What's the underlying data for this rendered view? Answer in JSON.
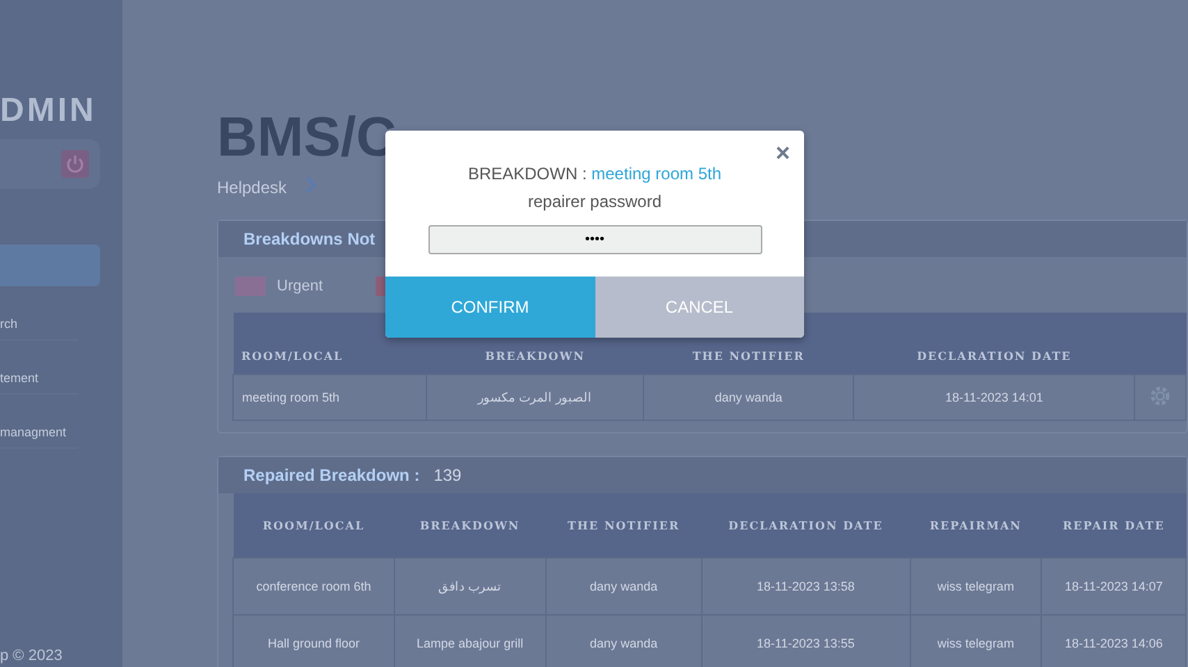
{
  "sidebar": {
    "role": "DMIN",
    "items": [
      {
        "label": "rch",
        "selected": false
      },
      {
        "label": "tement",
        "selected": false
      },
      {
        "label": "managment",
        "selected": false
      }
    ],
    "footer": "p © 2023"
  },
  "page": {
    "title": "BMS/C",
    "breadcrumb": "Helpdesk"
  },
  "pending_panel": {
    "title": "Breakdowns Not",
    "legend": [
      {
        "label": "Urgent",
        "color": "#8a6f95"
      },
      {
        "color": "#8e5e78"
      }
    ],
    "columns": [
      "ROOM/LOCAL",
      "BREAKDOWN",
      "THE NOTIFIER",
      "DECLARATION DATE"
    ],
    "rows": [
      [
        "meeting room 5th",
        "الصبور المرت مكسور",
        "dany wanda",
        "18-11-2023 14:01"
      ]
    ]
  },
  "repaired_panel": {
    "title": "Repaired Breakdown :",
    "count": "139",
    "columns": [
      "ROOM/LOCAL",
      "BREAKDOWN",
      "THE NOTIFIER",
      "DECLARATION DATE",
      "REPAIRMAN",
      "REPAIR DATE"
    ],
    "rows": [
      [
        "conference room 6th",
        "تسرب دافق",
        "dany wanda",
        "18-11-2023 13:58",
        "wiss telegram",
        "18-11-2023 14:07"
      ],
      [
        "Hall ground floor",
        "Lampe abajour grill",
        "dany wanda",
        "18-11-2023 13:55",
        "wiss telegram",
        "18-11-2023 14:06"
      ]
    ]
  },
  "dialog": {
    "label": "BREAKDOWN :",
    "room": "meeting room 5th",
    "prompt": "repairer password",
    "value": "••••",
    "confirm": "CONFIRM",
    "cancel": "CANCEL",
    "close": "×"
  }
}
